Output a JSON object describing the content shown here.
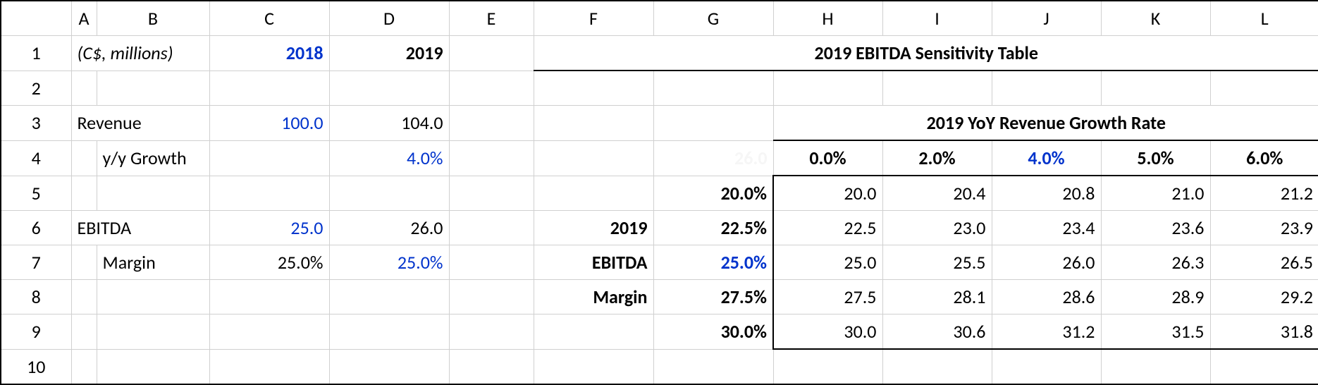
{
  "col_headers": [
    "A",
    "B",
    "C",
    "D",
    "E",
    "F",
    "G",
    "H",
    "I",
    "J",
    "K",
    "L"
  ],
  "row_headers": [
    "1",
    "2",
    "3",
    "4",
    "5",
    "6",
    "7",
    "8",
    "9",
    "10"
  ],
  "left": {
    "units": "(C$, millions)",
    "year_c": "2018",
    "year_d": "2019",
    "revenue_label": "Revenue",
    "revenue_c": "100.0",
    "revenue_d": "104.0",
    "yy_growth_label": "y/y Growth",
    "yy_growth_d": "4.0%",
    "ebitda_label": "EBITDA",
    "ebitda_c": "25.0",
    "ebitda_d": "26.0",
    "margin_label": "Margin",
    "margin_c": "25.0%",
    "margin_d": "25.0%"
  },
  "sens": {
    "title": "2019 EBITDA Sensitivity Table",
    "growth_title": "2019 YoY Revenue Growth Rate",
    "growth_pcts": [
      "0.0%",
      "2.0%",
      "4.0%",
      "5.0%",
      "6.0%"
    ],
    "g4_ghost": "26.0",
    "row_label_top": "2019",
    "row_label_mid": "EBITDA",
    "row_label_bot": "Margin",
    "margin_pcts": [
      "20.0%",
      "22.5%",
      "25.0%",
      "27.5%",
      "30.0%"
    ],
    "grid": [
      [
        "20.0",
        "20.4",
        "20.8",
        "21.0",
        "21.2"
      ],
      [
        "22.5",
        "23.0",
        "23.4",
        "23.6",
        "23.9"
      ],
      [
        "25.0",
        "25.5",
        "26.0",
        "26.3",
        "26.5"
      ],
      [
        "27.5",
        "28.1",
        "28.6",
        "28.9",
        "29.2"
      ],
      [
        "30.0",
        "30.6",
        "31.2",
        "31.5",
        "31.8"
      ]
    ]
  },
  "chart_data": {
    "type": "table",
    "title": "2019 EBITDA Sensitivity Table",
    "xlabel": "2019 YoY Revenue Growth Rate",
    "ylabel": "2019 EBITDA Margin",
    "x_categories": [
      "0.0%",
      "2.0%",
      "4.0%",
      "5.0%",
      "6.0%"
    ],
    "y_categories": [
      "20.0%",
      "22.5%",
      "25.0%",
      "27.5%",
      "30.0%"
    ],
    "values": [
      [
        20.0,
        20.4,
        20.8,
        21.0,
        21.2
      ],
      [
        22.5,
        23.0,
        23.4,
        23.6,
        23.9
      ],
      [
        25.0,
        25.5,
        26.0,
        26.3,
        26.5
      ],
      [
        27.5,
        28.1,
        28.6,
        28.9,
        29.2
      ],
      [
        30.0,
        30.6,
        31.2,
        31.5,
        31.8
      ]
    ],
    "inputs": {
      "revenue_2018": 100.0,
      "revenue_2019": 104.0,
      "yoy_growth_2019": 0.04,
      "ebitda_2018": 25.0,
      "ebitda_2019": 26.0,
      "ebitda_margin_2018": 0.25,
      "ebitda_margin_2019": 0.25
    }
  }
}
